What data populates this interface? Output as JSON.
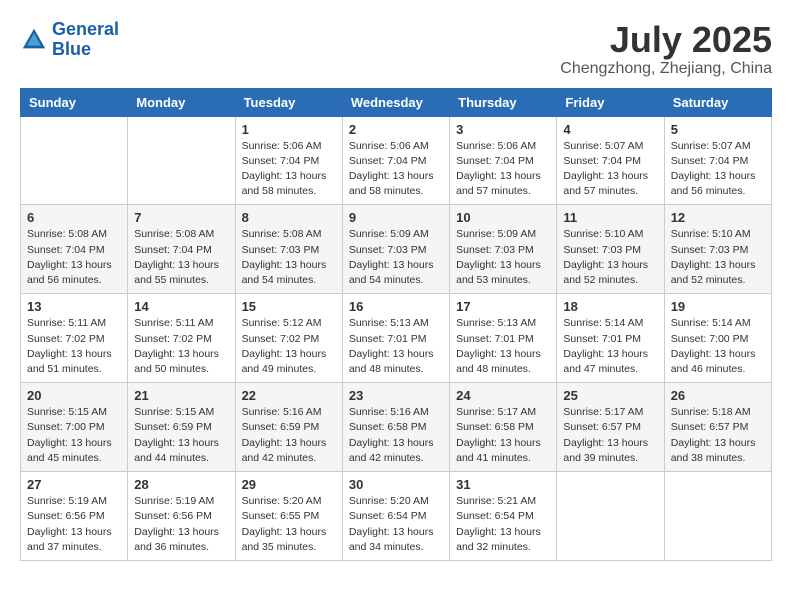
{
  "header": {
    "logo_line1": "General",
    "logo_line2": "Blue",
    "month_year": "July 2025",
    "location": "Chengzhong, Zhejiang, China"
  },
  "weekdays": [
    "Sunday",
    "Monday",
    "Tuesday",
    "Wednesday",
    "Thursday",
    "Friday",
    "Saturday"
  ],
  "weeks": [
    [
      {
        "day": "",
        "detail": ""
      },
      {
        "day": "",
        "detail": ""
      },
      {
        "day": "1",
        "detail": "Sunrise: 5:06 AM\nSunset: 7:04 PM\nDaylight: 13 hours\nand 58 minutes."
      },
      {
        "day": "2",
        "detail": "Sunrise: 5:06 AM\nSunset: 7:04 PM\nDaylight: 13 hours\nand 58 minutes."
      },
      {
        "day": "3",
        "detail": "Sunrise: 5:06 AM\nSunset: 7:04 PM\nDaylight: 13 hours\nand 57 minutes."
      },
      {
        "day": "4",
        "detail": "Sunrise: 5:07 AM\nSunset: 7:04 PM\nDaylight: 13 hours\nand 57 minutes."
      },
      {
        "day": "5",
        "detail": "Sunrise: 5:07 AM\nSunset: 7:04 PM\nDaylight: 13 hours\nand 56 minutes."
      }
    ],
    [
      {
        "day": "6",
        "detail": "Sunrise: 5:08 AM\nSunset: 7:04 PM\nDaylight: 13 hours\nand 56 minutes."
      },
      {
        "day": "7",
        "detail": "Sunrise: 5:08 AM\nSunset: 7:04 PM\nDaylight: 13 hours\nand 55 minutes."
      },
      {
        "day": "8",
        "detail": "Sunrise: 5:08 AM\nSunset: 7:03 PM\nDaylight: 13 hours\nand 54 minutes."
      },
      {
        "day": "9",
        "detail": "Sunrise: 5:09 AM\nSunset: 7:03 PM\nDaylight: 13 hours\nand 54 minutes."
      },
      {
        "day": "10",
        "detail": "Sunrise: 5:09 AM\nSunset: 7:03 PM\nDaylight: 13 hours\nand 53 minutes."
      },
      {
        "day": "11",
        "detail": "Sunrise: 5:10 AM\nSunset: 7:03 PM\nDaylight: 13 hours\nand 52 minutes."
      },
      {
        "day": "12",
        "detail": "Sunrise: 5:10 AM\nSunset: 7:03 PM\nDaylight: 13 hours\nand 52 minutes."
      }
    ],
    [
      {
        "day": "13",
        "detail": "Sunrise: 5:11 AM\nSunset: 7:02 PM\nDaylight: 13 hours\nand 51 minutes."
      },
      {
        "day": "14",
        "detail": "Sunrise: 5:11 AM\nSunset: 7:02 PM\nDaylight: 13 hours\nand 50 minutes."
      },
      {
        "day": "15",
        "detail": "Sunrise: 5:12 AM\nSunset: 7:02 PM\nDaylight: 13 hours\nand 49 minutes."
      },
      {
        "day": "16",
        "detail": "Sunrise: 5:13 AM\nSunset: 7:01 PM\nDaylight: 13 hours\nand 48 minutes."
      },
      {
        "day": "17",
        "detail": "Sunrise: 5:13 AM\nSunset: 7:01 PM\nDaylight: 13 hours\nand 48 minutes."
      },
      {
        "day": "18",
        "detail": "Sunrise: 5:14 AM\nSunset: 7:01 PM\nDaylight: 13 hours\nand 47 minutes."
      },
      {
        "day": "19",
        "detail": "Sunrise: 5:14 AM\nSunset: 7:00 PM\nDaylight: 13 hours\nand 46 minutes."
      }
    ],
    [
      {
        "day": "20",
        "detail": "Sunrise: 5:15 AM\nSunset: 7:00 PM\nDaylight: 13 hours\nand 45 minutes."
      },
      {
        "day": "21",
        "detail": "Sunrise: 5:15 AM\nSunset: 6:59 PM\nDaylight: 13 hours\nand 44 minutes."
      },
      {
        "day": "22",
        "detail": "Sunrise: 5:16 AM\nSunset: 6:59 PM\nDaylight: 13 hours\nand 42 minutes."
      },
      {
        "day": "23",
        "detail": "Sunrise: 5:16 AM\nSunset: 6:58 PM\nDaylight: 13 hours\nand 42 minutes."
      },
      {
        "day": "24",
        "detail": "Sunrise: 5:17 AM\nSunset: 6:58 PM\nDaylight: 13 hours\nand 41 minutes."
      },
      {
        "day": "25",
        "detail": "Sunrise: 5:17 AM\nSunset: 6:57 PM\nDaylight: 13 hours\nand 39 minutes."
      },
      {
        "day": "26",
        "detail": "Sunrise: 5:18 AM\nSunset: 6:57 PM\nDaylight: 13 hours\nand 38 minutes."
      }
    ],
    [
      {
        "day": "27",
        "detail": "Sunrise: 5:19 AM\nSunset: 6:56 PM\nDaylight: 13 hours\nand 37 minutes."
      },
      {
        "day": "28",
        "detail": "Sunrise: 5:19 AM\nSunset: 6:56 PM\nDaylight: 13 hours\nand 36 minutes."
      },
      {
        "day": "29",
        "detail": "Sunrise: 5:20 AM\nSunset: 6:55 PM\nDaylight: 13 hours\nand 35 minutes."
      },
      {
        "day": "30",
        "detail": "Sunrise: 5:20 AM\nSunset: 6:54 PM\nDaylight: 13 hours\nand 34 minutes."
      },
      {
        "day": "31",
        "detail": "Sunrise: 5:21 AM\nSunset: 6:54 PM\nDaylight: 13 hours\nand 32 minutes."
      },
      {
        "day": "",
        "detail": ""
      },
      {
        "day": "",
        "detail": ""
      }
    ]
  ]
}
